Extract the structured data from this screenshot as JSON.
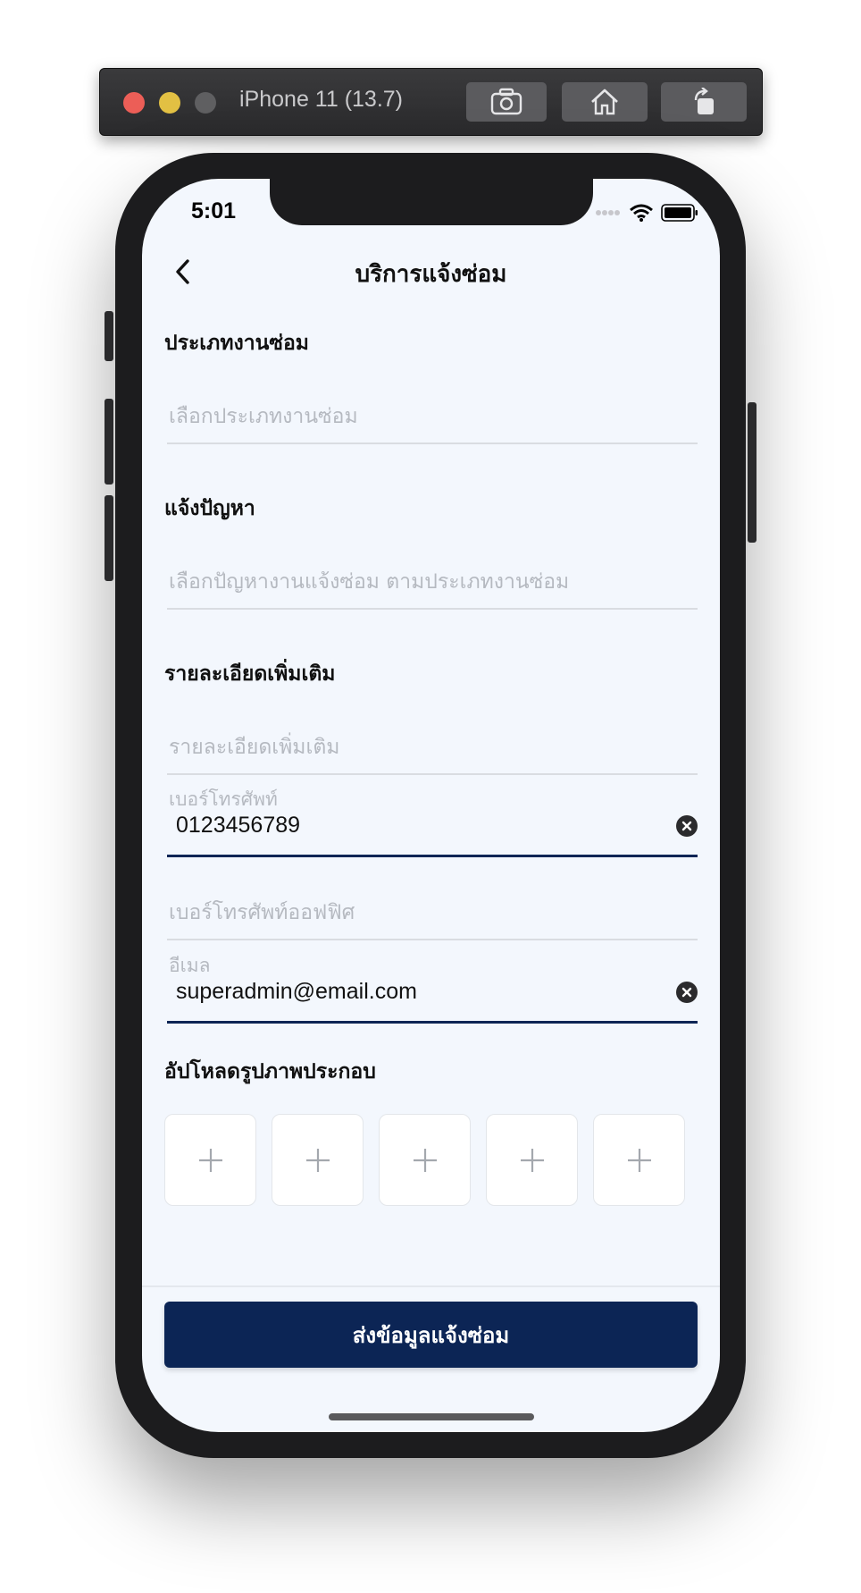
{
  "simulator": {
    "title": "iPhone 11 (13.7)"
  },
  "status_bar": {
    "time": "5:01"
  },
  "header": {
    "title": "บริการแจ้งซ่อม"
  },
  "form": {
    "repair_type": {
      "label": "ประเภทงานซ่อม",
      "placeholder": "เลือกประเภทงานซ่อม"
    },
    "problem": {
      "label": "แจ้งปัญหา",
      "placeholder": "เลือกปัญหางานแจ้งซ่อม ตามประเภทงานซ่อม"
    },
    "details": {
      "label": "รายละเอียดเพิ่มเติม",
      "placeholder": "รายละเอียดเพิ่มเติม"
    },
    "phone": {
      "label": "เบอร์โทรศัพท์",
      "value": "0123456789"
    },
    "office_phone": {
      "placeholder": "เบอร์โทรศัพท์ออฟฟิศ"
    },
    "email": {
      "label": "อีเมล",
      "value": "superadmin@email.com"
    },
    "upload": {
      "label": "อัปโหลดรูปภาพประกอบ",
      "slots": [
        "+",
        "+",
        "+",
        "+",
        "+"
      ]
    }
  },
  "footer": {
    "submit_label": "ส่งข้อมูลแจ้งซ่อม"
  },
  "colors": {
    "primary": "#0c2555",
    "background": "#f3f7fd"
  }
}
